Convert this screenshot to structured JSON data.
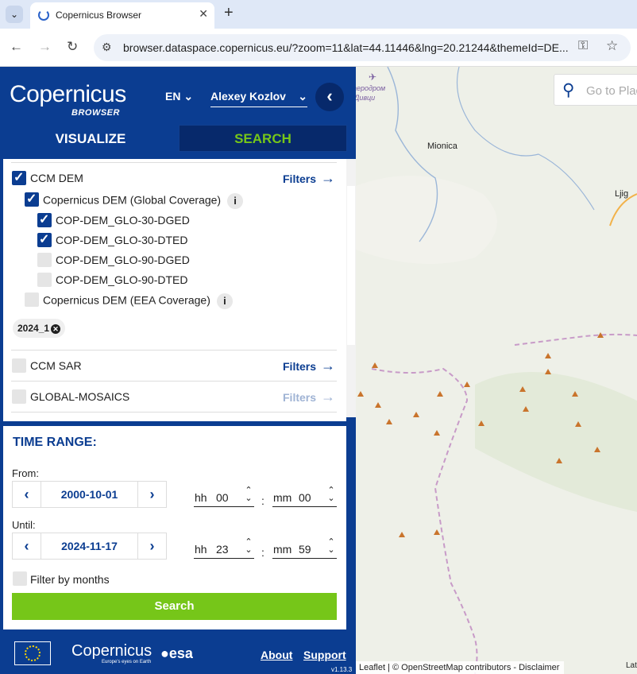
{
  "browser": {
    "tab_title": "Copernicus Browser",
    "new_tab": "+",
    "url": "browser.dataspace.copernicus.eu/?zoom=11&lat=44.11446&lng=20.21244&themeId=DE..."
  },
  "header": {
    "logo_main": "Copernicus",
    "logo_sub": "BROWSER",
    "language": "EN",
    "user": "Alexey Kozlov",
    "tab_visualize": "VISUALIZE",
    "tab_search": "SEARCH"
  },
  "collections": {
    "ccm_dem": {
      "label": "CCM DEM",
      "checked": true,
      "filters": "Filters"
    },
    "cop_dem_global": {
      "label": "Copernicus DEM (Global Coverage)",
      "checked": true
    },
    "items": [
      {
        "label": "COP-DEM_GLO-30-DGED",
        "checked": true
      },
      {
        "label": "COP-DEM_GLO-30-DTED",
        "checked": true
      },
      {
        "label": "COP-DEM_GLO-90-DGED",
        "checked": false
      },
      {
        "label": "COP-DEM_GLO-90-DTED",
        "checked": false
      }
    ],
    "cop_dem_eea": {
      "label": "Copernicus DEM (EEA Coverage)",
      "checked": false
    },
    "badge": "2024_1",
    "ccm_sar": {
      "label": "CCM SAR",
      "checked": false,
      "filters": "Filters"
    },
    "global_mosaics": {
      "label": "GLOBAL-MOSAICS",
      "checked": false,
      "filters": "Filters"
    }
  },
  "time_range": {
    "title": "TIME RANGE:",
    "from_label": "From:",
    "from_date": "2000-10-01",
    "from_hh": "00",
    "from_mm": "00",
    "until_label": "Until:",
    "until_date": "2024-11-17",
    "until_hh": "23",
    "until_mm": "59",
    "hh_label": "hh",
    "mm_label": "mm",
    "filter_months": "Filter by months",
    "search_button": "Search"
  },
  "footer": {
    "logo": "opernicus",
    "logo_sub": "Europe's eyes on Earth",
    "esa": "esa",
    "about": "About",
    "support": "Support",
    "version": "v1.13.3"
  },
  "map": {
    "search_placeholder": "Go to Plac",
    "places": [
      "Mionica",
      "Ljig",
      "аеродром",
      "Дивци"
    ],
    "attribution": "Leaflet | © OpenStreetMap contributors - Disclaimer",
    "attribution2": "Lat"
  }
}
